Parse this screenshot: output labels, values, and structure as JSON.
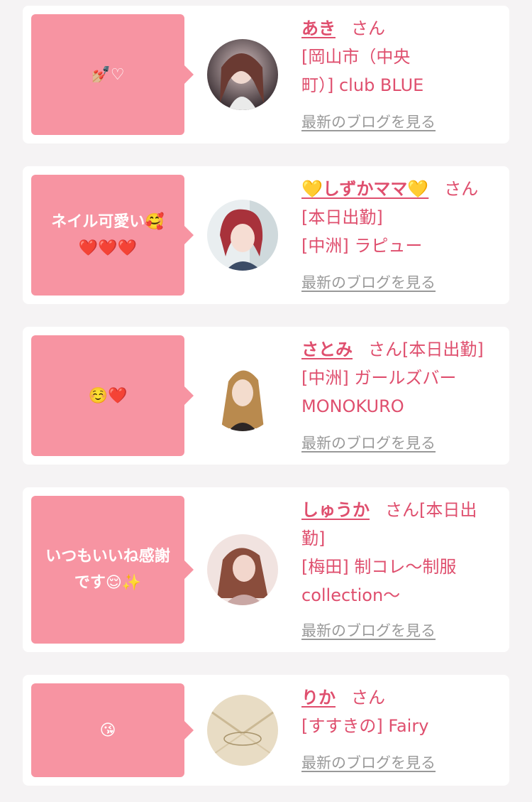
{
  "cards": [
    {
      "message": "💅🏼♡",
      "name": "あき",
      "honorific": "さん",
      "line1": "[岡山市（中央",
      "line2": "町）] club BLUE",
      "line3": "",
      "line4": "",
      "blog_link": "最新のブログを見る"
    },
    {
      "message": "ネイル可愛い🥰\n❤️❤️❤️",
      "name": "💛しずかママ💛",
      "honorific": "さん",
      "line1": "[本日出勤]",
      "line2": "[中洲] ラピュー",
      "line3": "",
      "line4": "",
      "blog_link": "最新のブログを見る"
    },
    {
      "message": "☺️❤️",
      "name": "さとみ",
      "honorific": "さん[本日出勤]",
      "line1": "[中洲] ガールズバー",
      "line2": "MONOKURO",
      "line3": "",
      "line4": "",
      "blog_link": "最新のブログを見る"
    },
    {
      "message": "いつもいいね感謝\nです😌✨",
      "name": "しゅうか",
      "honorific": "さん[本日出",
      "line1": "勤]",
      "line2": "[梅田] 制コレ〜制服",
      "line3": "collection〜",
      "line4": "",
      "blog_link": "最新のブログを見る"
    },
    {
      "message": "😘",
      "name": "りか",
      "honorific": "さん",
      "line1": "[すすきの] Fairy",
      "line2": "",
      "line3": "",
      "line4": "",
      "blog_link": "最新のブログを見る"
    }
  ],
  "colors": {
    "accent": "#df4f6e",
    "bubble": "#f794a2",
    "link_gray": "#999999",
    "background": "#f5f3f4"
  }
}
